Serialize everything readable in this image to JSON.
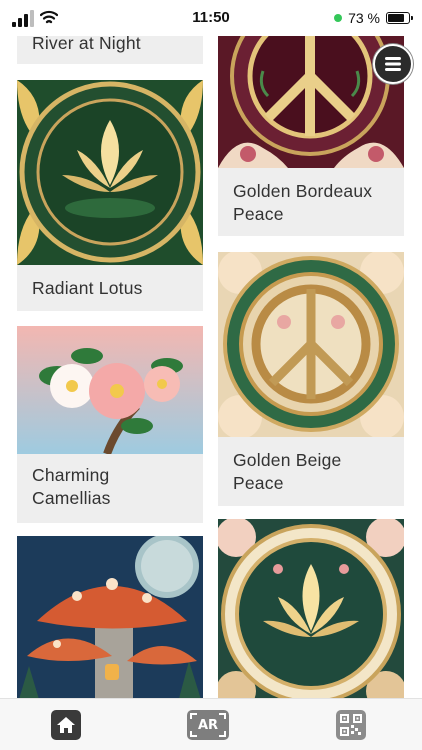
{
  "status_bar": {
    "time": "11:50",
    "battery_percent_label": "73 %",
    "battery_level": 0.73
  },
  "cards": [
    {
      "title": "River at Night"
    },
    {
      "title": "Golden Bordeaux Peace"
    },
    {
      "title": "Radiant Lotus"
    },
    {
      "title": "Charming Camellias"
    },
    {
      "title": "Golden Beige Peace"
    },
    {
      "title": ""
    },
    {
      "title": ""
    }
  ],
  "tab_bar": {
    "ar_label": "AR",
    "icons": [
      "home-icon",
      "ar-icon",
      "qr-code-icon"
    ]
  },
  "colors": {
    "status_dot": "#34c759",
    "card_background": "#eeeeee",
    "card_text": "#333333",
    "tab_bar_background": "#f7f7f7"
  }
}
